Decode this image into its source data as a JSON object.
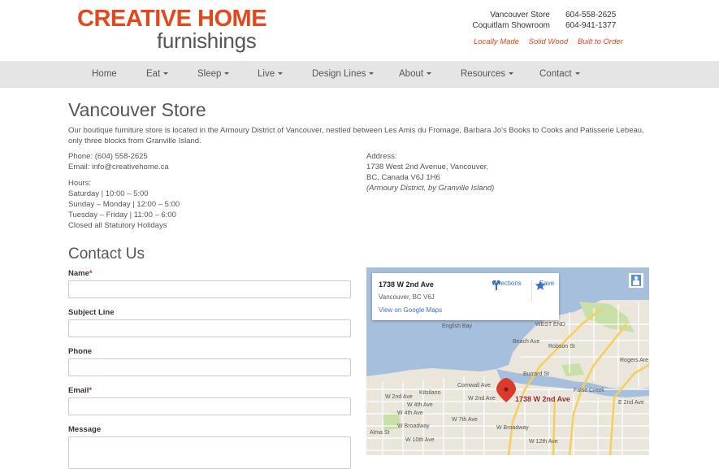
{
  "header": {
    "logo_top": "CREATIVE HOME",
    "logo_bottom": "furnishings",
    "locations": [
      {
        "name": "Vancouver Store",
        "phone": "604-558-2625"
      },
      {
        "name": "Coquitlam Showroom",
        "phone": "604-941-1377"
      }
    ],
    "taglines": [
      "Locally Made",
      "Solid Wood",
      "Built to Order"
    ]
  },
  "nav": {
    "items": [
      {
        "label": "Home",
        "dropdown": false
      },
      {
        "label": "Eat",
        "dropdown": true
      },
      {
        "label": "Sleep",
        "dropdown": true
      },
      {
        "label": "Live",
        "dropdown": true
      },
      {
        "label": "Design Lines",
        "dropdown": true
      },
      {
        "label": "About",
        "dropdown": true
      },
      {
        "label": "Resources",
        "dropdown": true
      },
      {
        "label": "Contact",
        "dropdown": true
      }
    ]
  },
  "page": {
    "title": "Vancouver Store",
    "intro": "Our boutique furniture store is located in the Armoury District of Vancouver, nestled between Les Amis du Fromage, Barbara Jo's Books to Cooks and Patisserie Lebeau, only three blocks from Granville Island.",
    "phone": "Phone: (604) 558-2625",
    "email": "Email: info@creativehome.ca",
    "hours_heading": "Hours:",
    "hours": [
      "Saturday | 10:00 – 5:00",
      "Sunday – Monday | 12:00 – 5:00",
      "Tuesday – Friday | 11:00 – 6:00",
      "Closed all Statutory Holidays"
    ],
    "address_heading": "Address:",
    "address_line1": "1738 West 2nd Avenue, Vancouver,",
    "address_line2": "BC, Canada V6J 1H6",
    "address_note": "(Armoury District, by Granville Island)"
  },
  "contact_form": {
    "title": "Contact Us",
    "fields": [
      {
        "label": "Name",
        "required": true,
        "value": ""
      },
      {
        "label": "Subject Line",
        "required": false,
        "value": ""
      },
      {
        "label": "Phone",
        "required": false,
        "value": ""
      },
      {
        "label": "Email",
        "required": true,
        "value": ""
      },
      {
        "label": "Message",
        "required": false,
        "value": ""
      }
    ],
    "required_mark": "*"
  },
  "map": {
    "card_title": "1738 W 2nd Ave",
    "card_subtitle": "Vancouver, BC V6J",
    "card_link": "View on Google Maps",
    "directions_label": "Directions",
    "save_label": "Save",
    "pin_label": "1738 W 2nd Ave",
    "labels": {
      "english_bay": "English Bay",
      "west_end": "WEST END",
      "false_creek": "False Creek",
      "kitsilano": "Kitsilano",
      "cornwall": "Cornwall Ave",
      "w2nd": "W 2nd Ave",
      "w4th": "W 4th Ave",
      "w7th": "W 7th Ave",
      "broadway": "W Broadway",
      "w10th": "W 10th Ave",
      "w12th": "W 12th Ave",
      "e2nd": "E 2nd Ave",
      "rogers": "Rogers Are",
      "burrard": "Burrard St",
      "robson": "Robson St",
      "beach": "Beach Ave",
      "alma": "Alma St"
    },
    "colors": {
      "water": "#a5bfdd",
      "land": "#ebe6dc",
      "park": "#c8dfa8",
      "highway": "#f5cf5b",
      "pin": "#d93a2b"
    }
  }
}
